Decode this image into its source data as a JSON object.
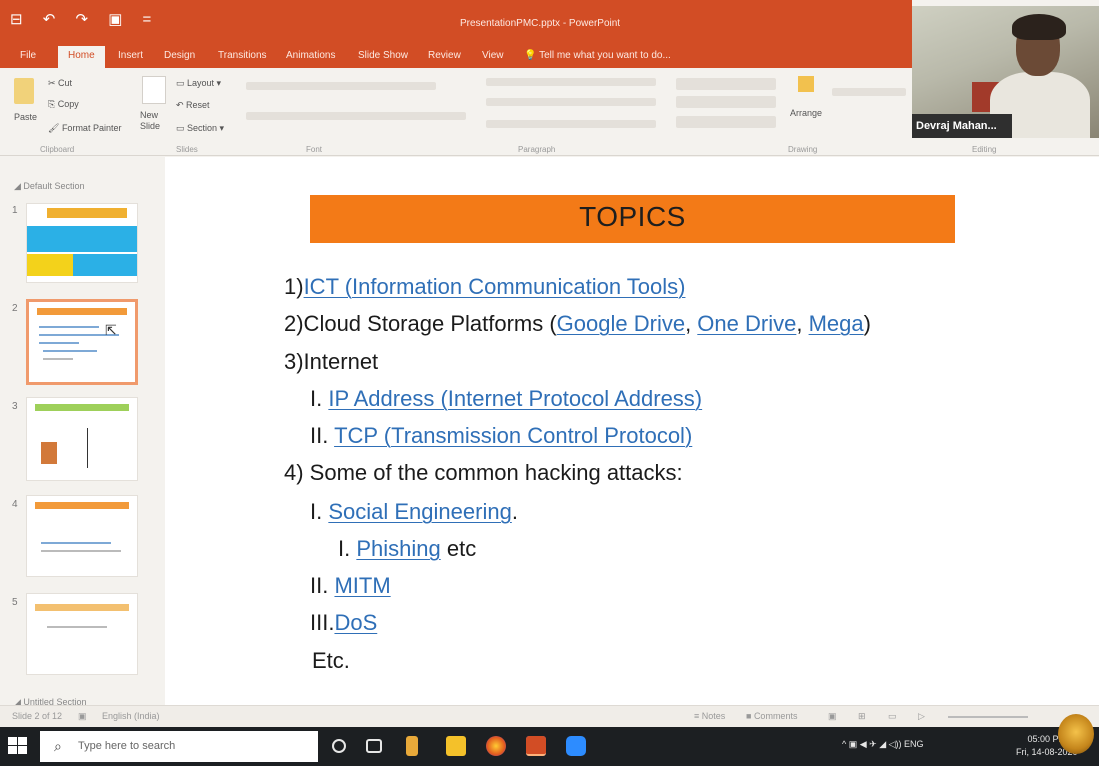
{
  "app": {
    "window_title": "PresentationPMC.pptx - PowerPoint",
    "quick_access": "⊟ ↶ ↷ ▣ ="
  },
  "ribbon": {
    "tabs": [
      "File",
      "Home",
      "Insert",
      "Design",
      "Transitions",
      "Animations",
      "Slide Show",
      "Review",
      "View"
    ],
    "active_tab": "Home",
    "tell_me": "Tell me what you want to do...",
    "clipboard": {
      "paste": "Paste",
      "cut": "Cut",
      "copy": "Copy",
      "format_painter": "Format Painter",
      "group": "Clipboard"
    },
    "slides": {
      "new_slide": "New Slide",
      "layout": "Layout",
      "reset": "Reset",
      "section": "Section",
      "group": "Slides"
    },
    "font_group": "Font",
    "paragraph_group": "Paragraph",
    "drawing": {
      "arrange": "Arrange",
      "group": "Drawing"
    },
    "editing_group": "Editing"
  },
  "video": {
    "name": "Devraj Mahan..."
  },
  "thumbnails": {
    "section_top": "Default Section",
    "section_bottom": "Untitled Section",
    "numbers": [
      "1",
      "2",
      "3",
      "4",
      "5"
    ]
  },
  "slide": {
    "title": "TOPICS",
    "l1_prefix": "1)",
    "l1_link": "ICT (Information Communication Tools)",
    "l2_prefix": "2)Cloud Storage Platforms (",
    "l2_link1": "Google Drive",
    "l2_sep1": ", ",
    "l2_link2": "One Drive",
    "l2_sep2": ", ",
    "l2_link3": "Mega",
    "l2_suffix": ")",
    "l3": "3)Internet",
    "l3a_prefix": "I. ",
    "l3a_link": "IP Address (Internet Protocol Address)",
    "l3b_prefix": "II. ",
    "l3b_link": "TCP (Transmission Control Protocol)",
    "l4": "4) Some of the common hacking attacks:",
    "l4a_prefix": "I. ",
    "l4a_link": "Social Engineering",
    "l4a_suffix": ".",
    "l4a1_prefix": "I. ",
    "l4a1_link": "Phishing",
    "l4a1_suffix": " etc",
    "l4b_prefix": "II. ",
    "l4b_link": "MITM",
    "l4c_prefix": "III.",
    "l4c_link": "DoS",
    "l5": "Etc."
  },
  "status": {
    "slide_count": "Slide 2 of 12",
    "language": "English (India)",
    "notes": "Notes",
    "comments": "Comments"
  },
  "taskbar": {
    "search_placeholder": "Type here to search",
    "tray": "^ ▣ ◀ ✈ ◢ ◁)) ENG",
    "time": "05:00 PM",
    "date": "Fri, 14-08-2020"
  },
  "colors": {
    "accent": "#d24d25",
    "topic_bar": "#f37a17",
    "link": "#2f6fb7"
  }
}
